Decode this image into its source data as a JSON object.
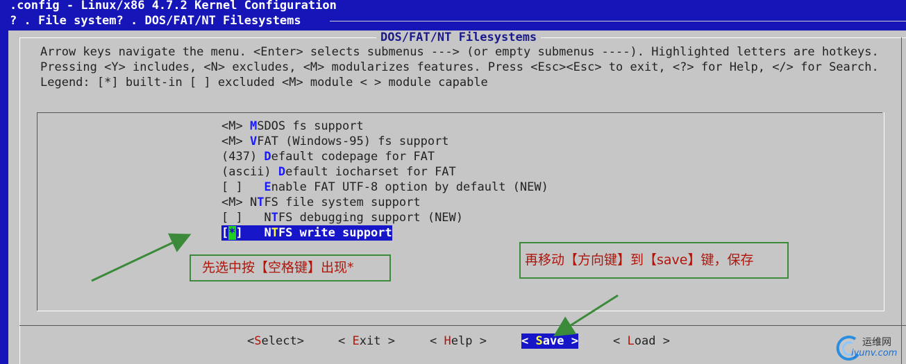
{
  "header": {
    "title_line": ".config - Linux/x86 4.7.2 Kernel Configuration",
    "breadcrumb": "? . File system? . DOS/FAT/NT Filesystems"
  },
  "dialog": {
    "title": "DOS/FAT/NT Filesystems",
    "help_text": "Arrow keys navigate the menu.  <Enter> selects submenus ---> (or empty submenus ----).  Highlighted letters are hotkeys.  Pressing <Y> includes, <N> excludes, <M> modularizes features.  Press <Esc><Esc> to exit, <?> for Help, </> for Search.  Legend: [*] built-in  [ ] excluded  <M> module  < > module capable"
  },
  "menu_items": [
    {
      "prefix": "<M> ",
      "hotkey": "M",
      "pre": "",
      "post": "SDOS fs support",
      "prefix_text": "<M> M",
      "rest": "SDOS fs support"
    },
    {
      "prefix": "<M> ",
      "hotkey": "V",
      "post": "FAT (Windows-95) fs support"
    },
    {
      "prefix": "(437) ",
      "hotkey": "D",
      "post": "efault codepage for FAT"
    },
    {
      "prefix": "(ascii) ",
      "hotkey": "D",
      "post": "efault iocharset for FAT"
    },
    {
      "prefix": "[ ]   ",
      "hotkey": "E",
      "post": "nable FAT UTF-8 option by default (NEW)"
    },
    {
      "prefix": "<M> N",
      "hotkey": "T",
      "post": "FS file system support"
    },
    {
      "prefix": "[ ]   N",
      "hotkey": "T",
      "post": "FS debugging support (NEW)"
    },
    {
      "prefix_open": "[",
      "cursor": "*",
      "prefix_close": "]   N",
      "hotkey": "T",
      "post": "FS write support"
    }
  ],
  "annotations": {
    "note1": "先选中按【空格键】出现*",
    "note2": "再移动【方向键】到【save】键，保存"
  },
  "buttons": [
    {
      "open": "<",
      "key": "S",
      "rest": "elect",
      "close": ">"
    },
    {
      "open": "< ",
      "key": "E",
      "rest": "xit",
      "close": " >"
    },
    {
      "open": "< ",
      "key": "H",
      "rest": "elp",
      "close": " >"
    },
    {
      "open": "< ",
      "key": "S",
      "rest": "ave",
      "close": " >"
    },
    {
      "open": "< ",
      "key": "L",
      "rest": "oad",
      "close": " >"
    }
  ],
  "watermark": {
    "name": "运维网",
    "url": "iyunv.com"
  },
  "colors": {
    "terminal_blue": "#1515b8",
    "dialog_gray": "#c6c6c6",
    "annotation_green": "#3a8a3a",
    "annotation_text": "#b0150c",
    "hotkey": "#1a1aff",
    "selected_hotkey": "#ffff40"
  }
}
